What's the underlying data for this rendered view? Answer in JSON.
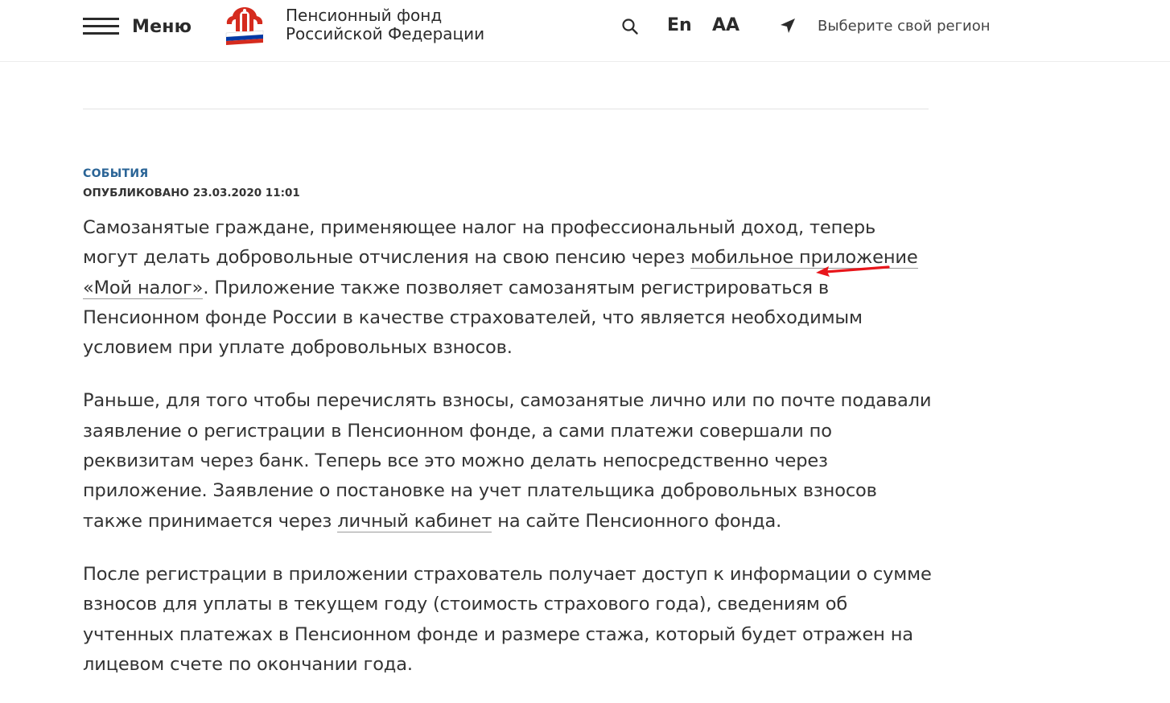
{
  "header": {
    "menu_label": "Меню",
    "org_name_line1": "Пенсионный фонд",
    "org_name_line2": "Российской Федерации",
    "lang_label": "En",
    "font_size_label": "AA",
    "region_label": "Выберите свой регион",
    "icons": {
      "menu": "hamburger-icon",
      "search": "search-icon",
      "region": "location-arrow-icon",
      "logo": "pfr-logo"
    }
  },
  "article": {
    "category": "СОБЫТИЯ",
    "published": "ОПУБЛИКОВАНО 23.03.2020 11:01",
    "p1_before": "Самозанятые граждане, применяющее налог на профессиональный доход, теперь могут делать добровольные отчисления на свою пенсию через ",
    "p1_link": "мобильное приложение «Мой налог»",
    "p1_after": ". Приложение также позволяет самозанятым регистрироваться в Пенсионном фонде России в качестве страхователей, что является необходимым условием при уплате добровольных взносов.",
    "p2_before": "Раньше, для того чтобы перечислять взносы, самозанятые лично или по почте подавали заявление о регистрации в Пенсионном фонде, а сами платежи совершали по реквизитам через банк. Теперь все это можно делать непосредственно через приложение. Заявление о постановке на учет плательщика добровольных взносов также принимается через ",
    "p2_link": "личный кабинет",
    "p2_after": " на сайте Пенсионного фонда.",
    "p3": "После регистрации в приложении страхователь получает доступ к информации о сумме взносов для уплаты в текущем году (стоимость страхового года), сведениям об учтенных платежах в Пенсионном фонде и размере стажа, который будет отражен на лицевом счете по окончании года."
  },
  "colors": {
    "accent_link": "#2a6496",
    "text": "#333333",
    "annotation_arrow": "#e8161b",
    "logo_red": "#d52b1e",
    "logo_blue": "#0039a6"
  }
}
